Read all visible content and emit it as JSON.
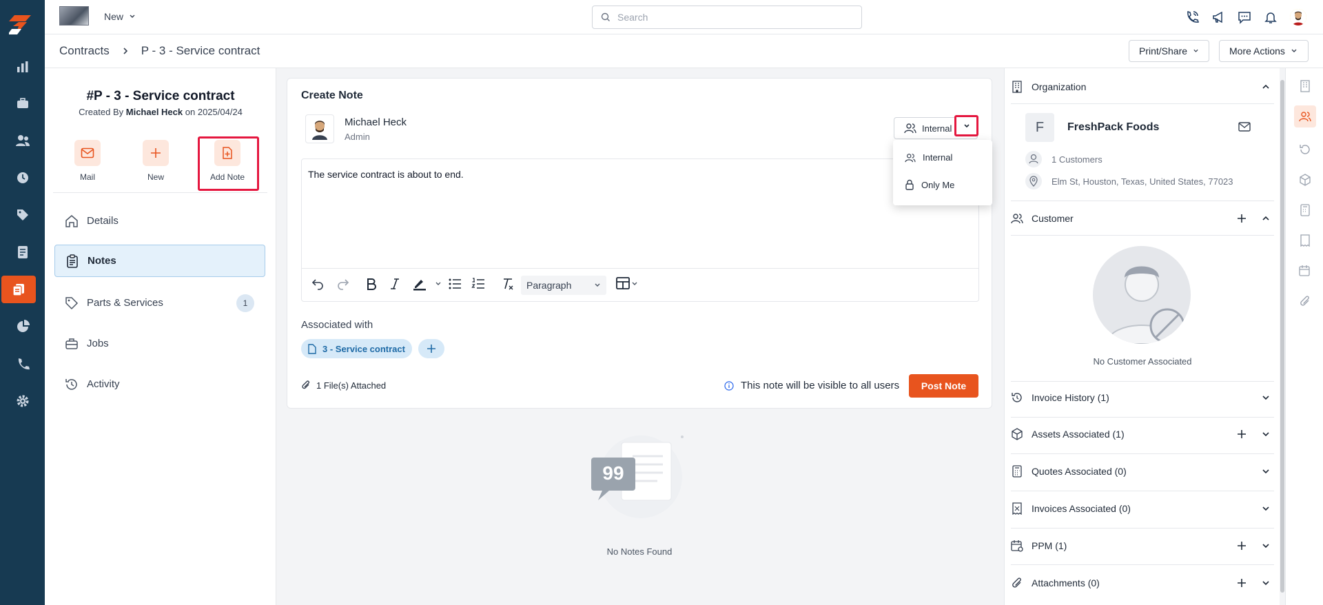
{
  "topbar": {
    "new_label": "New",
    "search_placeholder": "Search"
  },
  "breadcrumb": {
    "root": "Contracts",
    "current": "P - 3 - Service contract",
    "print_share": "Print/Share",
    "more_actions": "More Actions"
  },
  "record": {
    "title": "#P - 3 - Service contract",
    "created_prefix": "Created By",
    "created_by": "Michael Heck",
    "created_on_prefix": "on",
    "created_on": "2025/04/24",
    "actions": {
      "mail": "Mail",
      "new": "New",
      "add_note": "Add Note"
    },
    "menu": {
      "details": "Details",
      "notes": "Notes",
      "parts": "Parts & Services",
      "parts_count": "1",
      "jobs": "Jobs",
      "activity": "Activity"
    }
  },
  "note": {
    "header": "Create Note",
    "author_name": "Michael Heck",
    "author_role": "Admin",
    "visibility": "Internal",
    "body": "The service contract is about to end.",
    "format": "Paragraph",
    "associated_label": "Associated with",
    "associated_chip": "3 - Service contract",
    "files": "1 File(s) Attached",
    "visibility_note": "This note will be visible to all users",
    "post_label": "Post Note",
    "visibility_options": [
      "Internal",
      "Only Me"
    ]
  },
  "empty_state": {
    "label": "No Notes Found"
  },
  "right": {
    "organization_label": "Organization",
    "org_initial": "F",
    "org_name": "FreshPack Foods",
    "customers_count": "1 Customers",
    "address": "Elm St, Houston, Texas, United States, 77023",
    "customer_label": "Customer",
    "no_customer": "No Customer Associated",
    "invoice_history": "Invoice History (1)",
    "assets": "Assets Associated (1)",
    "quotes": "Quotes Associated (0)",
    "invoices": "Invoices Associated (0)",
    "ppm": "PPM (1)",
    "attachments": "Attachments (0)"
  },
  "colors": {
    "brand": "#e8541e",
    "nav_bg": "#173a52",
    "highlight": "#e5173f",
    "chip_bg": "#d6e9f8"
  }
}
